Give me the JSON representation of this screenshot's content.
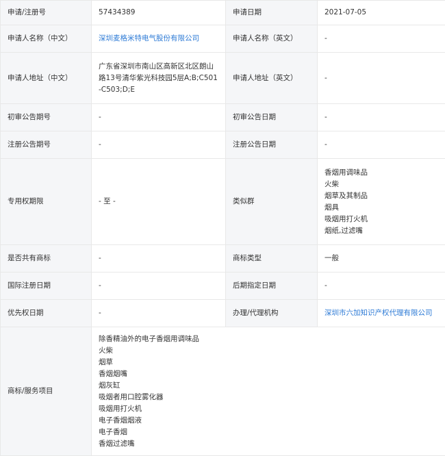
{
  "rows": {
    "reg_no": {
      "label": "申请/注册号",
      "value": "57434389"
    },
    "apply_date": {
      "label": "申请日期",
      "value": "2021-07-05"
    },
    "applicant_cn": {
      "label": "申请人名称（中文）",
      "value": "深圳麦格米特电气股份有限公司"
    },
    "applicant_en": {
      "label": "申请人名称（英文）",
      "value": "-"
    },
    "address_cn": {
      "label": "申请人地址（中文）",
      "lines": [
        "广东省深圳市南山区高新区北区朗山",
        "路13号清华紫光科技园5层A;B;C501",
        "-C503;D;E"
      ]
    },
    "address_en": {
      "label": "申请人地址（英文）",
      "value": "-"
    },
    "prelim_no": {
      "label": "初审公告期号",
      "value": "-"
    },
    "prelim_date": {
      "label": "初审公告日期",
      "value": "-"
    },
    "reg_pub_no": {
      "label": "注册公告期号",
      "value": "-"
    },
    "reg_pub_date": {
      "label": "注册公告日期",
      "value": "-"
    },
    "exclusive_period": {
      "label": "专用权期限",
      "value": "- 至 -"
    },
    "similar_group": {
      "label": "类似群",
      "items": [
        "香烟用调味品",
        "火柴",
        "烟草及其制品",
        "烟具",
        "吸烟用打火机",
        "烟纸,过滤嘴"
      ]
    },
    "shared": {
      "label": "是否共有商标",
      "value": "-"
    },
    "mark_type": {
      "label": "商标类型",
      "value": "一般"
    },
    "intl_reg_date": {
      "label": "国际注册日期",
      "value": "-"
    },
    "later_designation": {
      "label": "后期指定日期",
      "value": "-"
    },
    "priority_date": {
      "label": "优先权日期",
      "value": "-"
    },
    "agent": {
      "label": "办理/代理机构",
      "value": "深圳市六加知识产权代理有限公司"
    },
    "goods_services": {
      "label": "商标/服务项目",
      "items": [
        "除香精油外的电子香烟用调味品",
        "火柴",
        "烟草",
        "香烟烟嘴",
        "烟灰缸",
        "吸烟者用口腔雾化器",
        "吸烟用打火机",
        "电子香烟烟液",
        "电子香烟",
        "香烟过滤嘴"
      ]
    }
  }
}
